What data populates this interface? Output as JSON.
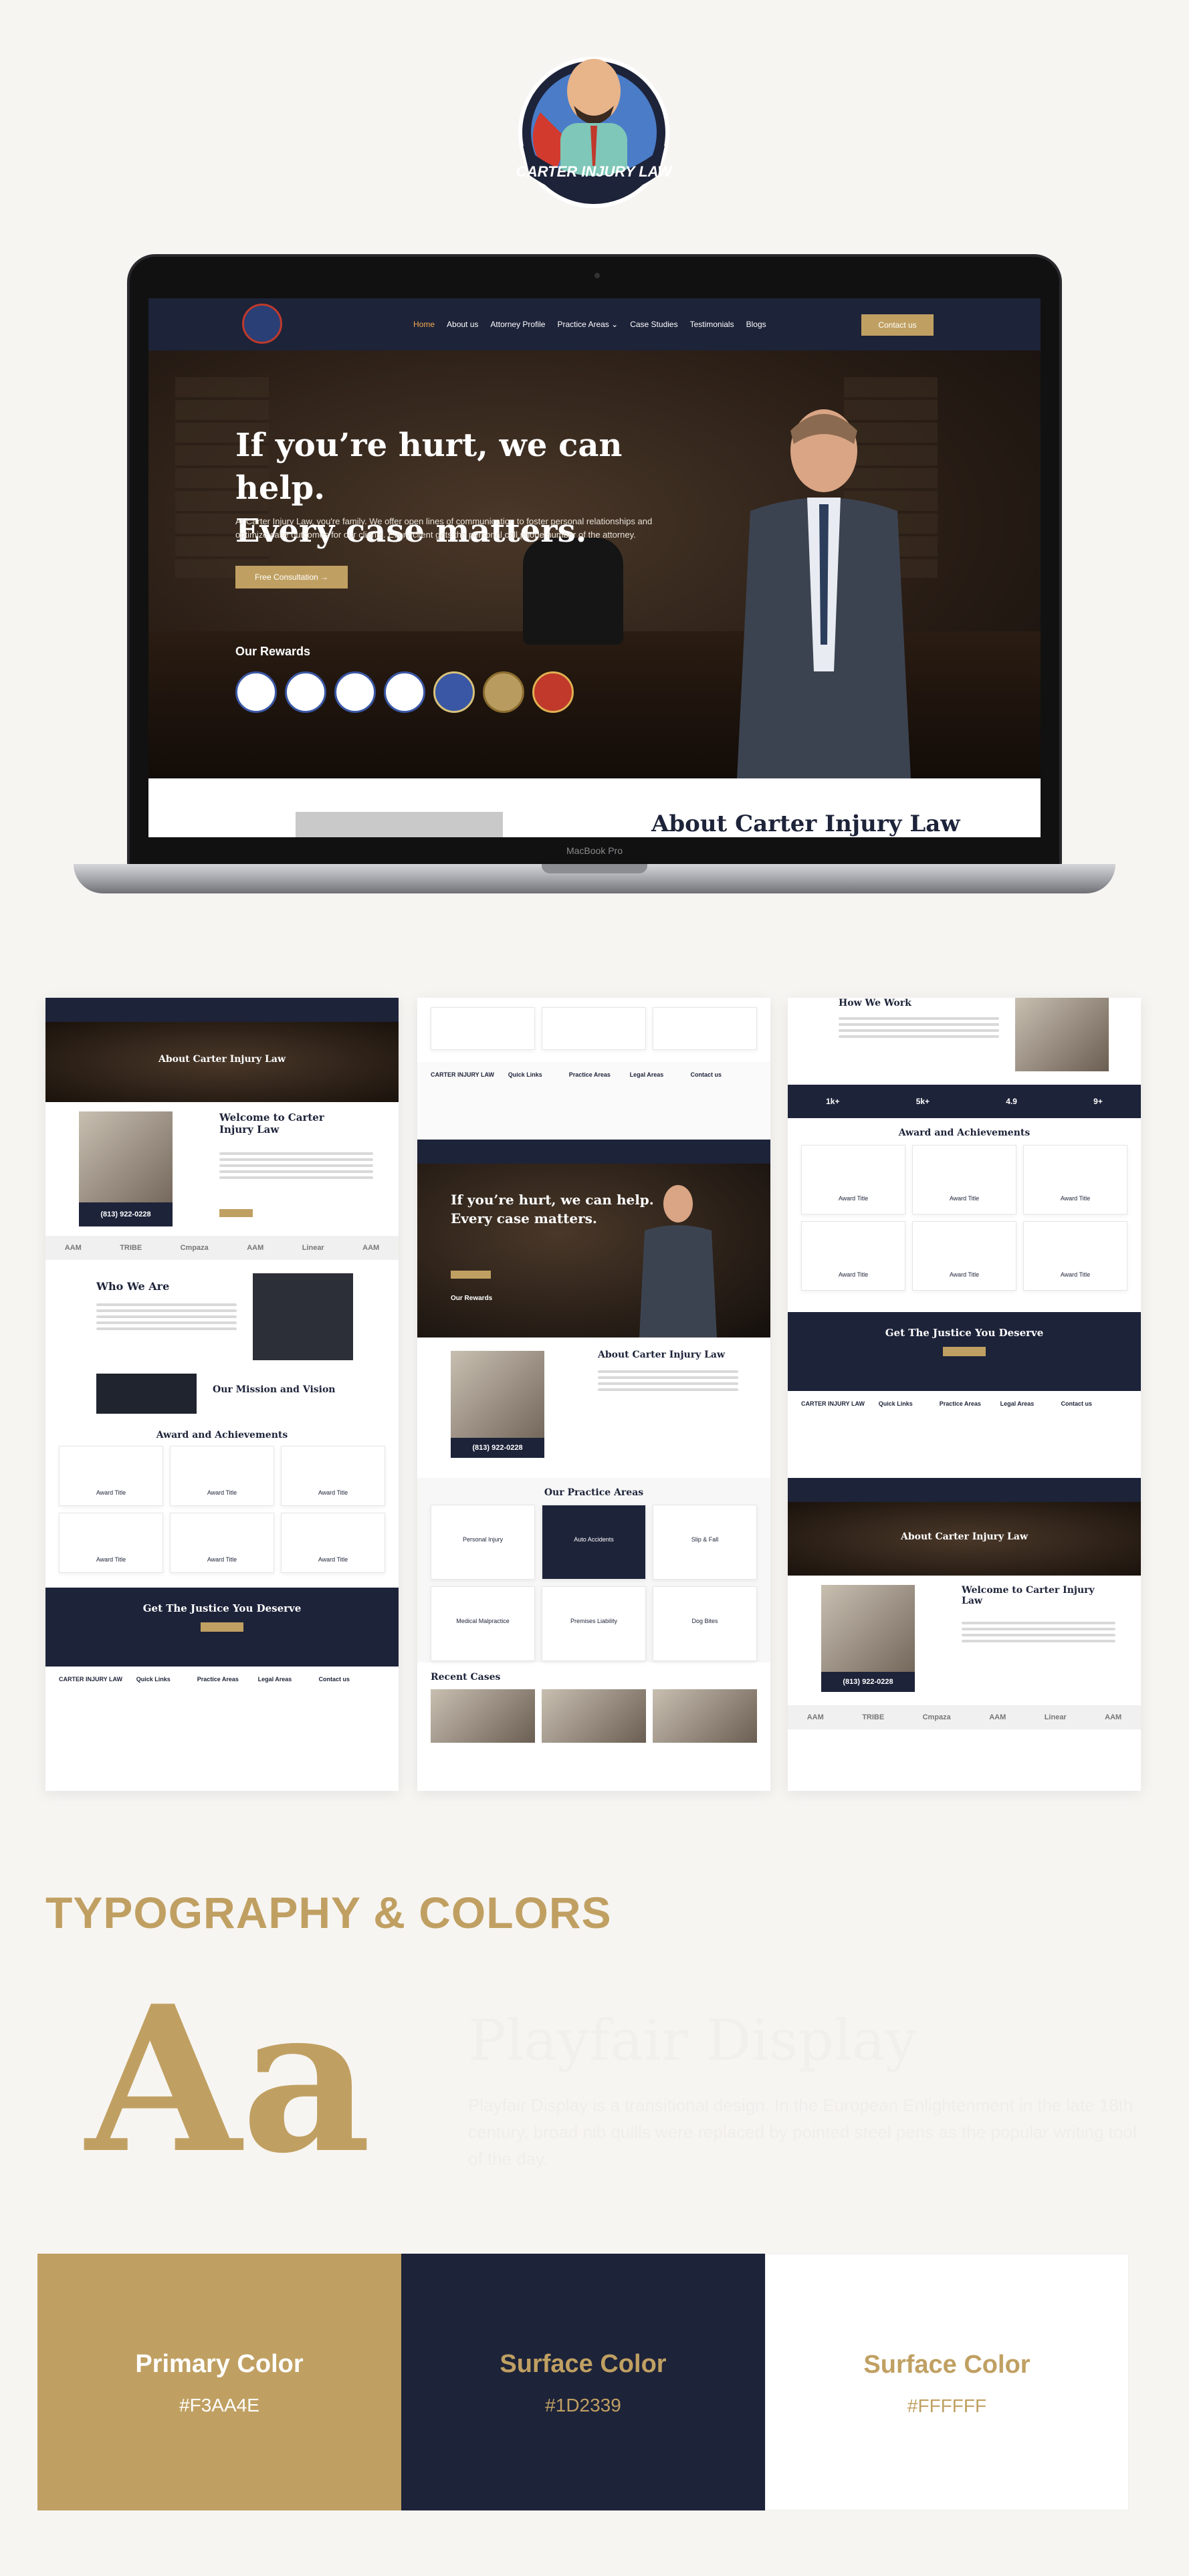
{
  "logo": {
    "text": "CARTER INJURY LAW"
  },
  "laptop": {
    "model_label": "MacBook Pro",
    "nav": {
      "links": [
        "Home",
        "About us",
        "Attorney Profile",
        "Practice Areas ⌄",
        "Case Studies",
        "Testimonials",
        "Blogs"
      ],
      "cta": "Contact us"
    },
    "hero": {
      "headline_line1": "If you’re hurt, we can help.",
      "headline_line2": "Every case matters.",
      "lead": "At Carter Injury Law, you're family. We offer open lines of communication to foster personal relationships and optimize case outcomes for our clients. Every client gets the personal cell phone number of the attorney.",
      "button": "Free Consultation  →",
      "rewards_title": "Our Rewards"
    },
    "next_section_title": "About Carter Injury Law"
  },
  "previews": {
    "left": {
      "banner_title": "About Carter Injury Law",
      "welcome_title": "Welcome to Carter Injury Law",
      "phone": "(813) 922-0228",
      "logos": [
        "AAM",
        "TRIBE",
        "Cmpaza",
        "AAM",
        "Linear",
        "AAM"
      ],
      "who_title": "Who We Are",
      "mission_title": "Our Mission and Vision",
      "award_title": "Award and Achievements",
      "award_card": "Award Title",
      "cta_title": "Get The Justice You Deserve",
      "footer_brand": "CARTER INJURY LAW",
      "footer_cols": [
        "Quick Links",
        "Practice Areas",
        "Legal Areas",
        "Contact us"
      ]
    },
    "middle": {
      "footer_brand": "CARTER INJURY LAW",
      "footer_cols": [
        "Quick Links",
        "Practice Areas",
        "Legal Areas",
        "Contact us"
      ],
      "hero_headline_line1": "If you’re hurt, we can help.",
      "hero_headline_line2": "Every case matters.",
      "rewards_title": "Our Rewards",
      "about_title": "About Carter Injury Law",
      "phone": "(813) 922-0228",
      "practice_title": "Our Practice Areas",
      "practice_areas": [
        "Personal Injury",
        "Auto Accidents",
        "Slip & Fall",
        "Medical Malpractice",
        "Premises Liability",
        "Dog Bites"
      ],
      "recent_title": "Recent Cases"
    },
    "right": {
      "how_title": "How We Work",
      "stats": [
        "1k+",
        "5k+",
        "4.9",
        "9+"
      ],
      "award_title": "Award and Achievements",
      "award_card": "Award Title",
      "cta_title": "Get The Justice You Deserve",
      "footer_brand": "CARTER INJURY LAW",
      "footer_cols": [
        "Quick Links",
        "Practice Areas",
        "Legal Areas",
        "Contact us"
      ],
      "banner_title": "About Carter Injury Law",
      "welcome_title": "Welcome to Carter Injury Law",
      "phone": "(813) 922-0228",
      "logos": [
        "AAM",
        "TRIBE",
        "Cmpaza",
        "AAM",
        "Linear",
        "AAM"
      ]
    }
  },
  "typography": {
    "heading": "TYPOGRAPHY & COLORS",
    "sample": "Aa",
    "font_name": "Playfair Display",
    "description": "Playfair Display is a transitional design. In the European Enlightenment in the late 18th century, broad nib quills were replaced by pointed steel pens as the popular writing tool of the day."
  },
  "colors": [
    {
      "name": "Primary Color",
      "hex": "#F3AA4E"
    },
    {
      "name": "Surface Color",
      "hex": "#1D2339"
    },
    {
      "name": "Surface Color",
      "hex": "#FFFFFF"
    }
  ]
}
